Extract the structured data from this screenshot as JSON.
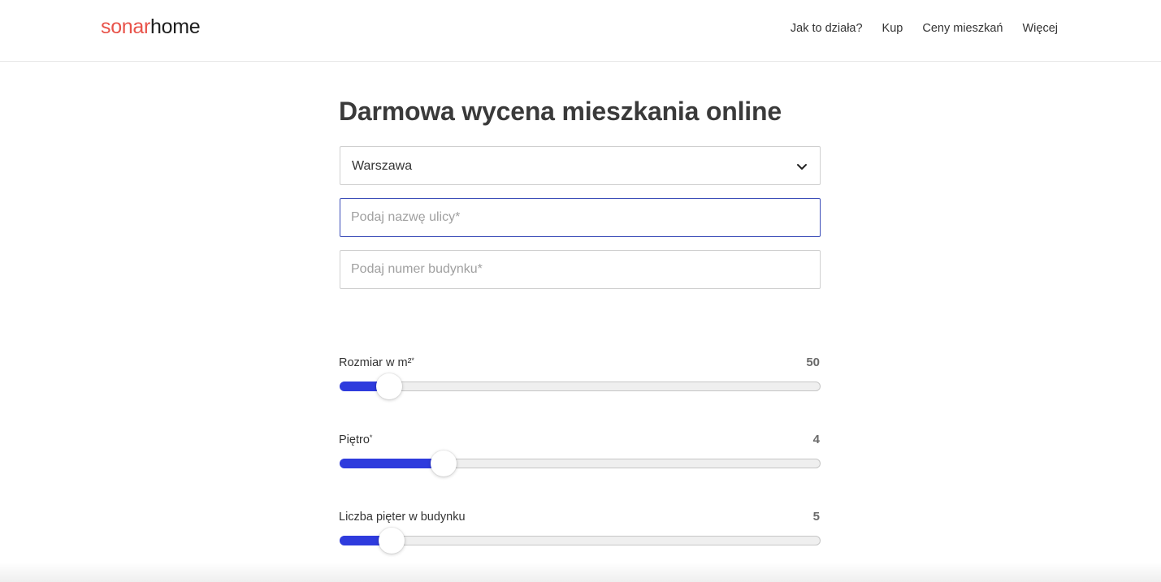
{
  "header": {
    "logo_part1": "sonar",
    "logo_part2": "home",
    "nav": [
      "Jak to działa?",
      "Kup",
      "Ceny mieszkań",
      "Więcej"
    ]
  },
  "form": {
    "title": "Darmowa wycena mieszkania online",
    "city_select": {
      "value": "Warszawa",
      "icon": "chevron-down-icon"
    },
    "street_input": {
      "value": "",
      "placeholder": "Podaj nazwę ulicy*"
    },
    "building_input": {
      "value": "",
      "placeholder": "Podaj numer budynku*"
    }
  },
  "sliders": [
    {
      "label": "Rozmiar w m²",
      "required": "*",
      "value": "50",
      "level_percent": 10.3
    },
    {
      "label": "Piętro",
      "required": "*",
      "value": "4",
      "level_percent": 21.6
    },
    {
      "label": "Liczba pięter w budynku",
      "required": "",
      "value": "5",
      "level_percent": 10.8
    }
  ],
  "colors": {
    "brand_red": "#e8534a",
    "accent_blue": "#2e3bdd",
    "focus_border": "#3b4db8"
  }
}
